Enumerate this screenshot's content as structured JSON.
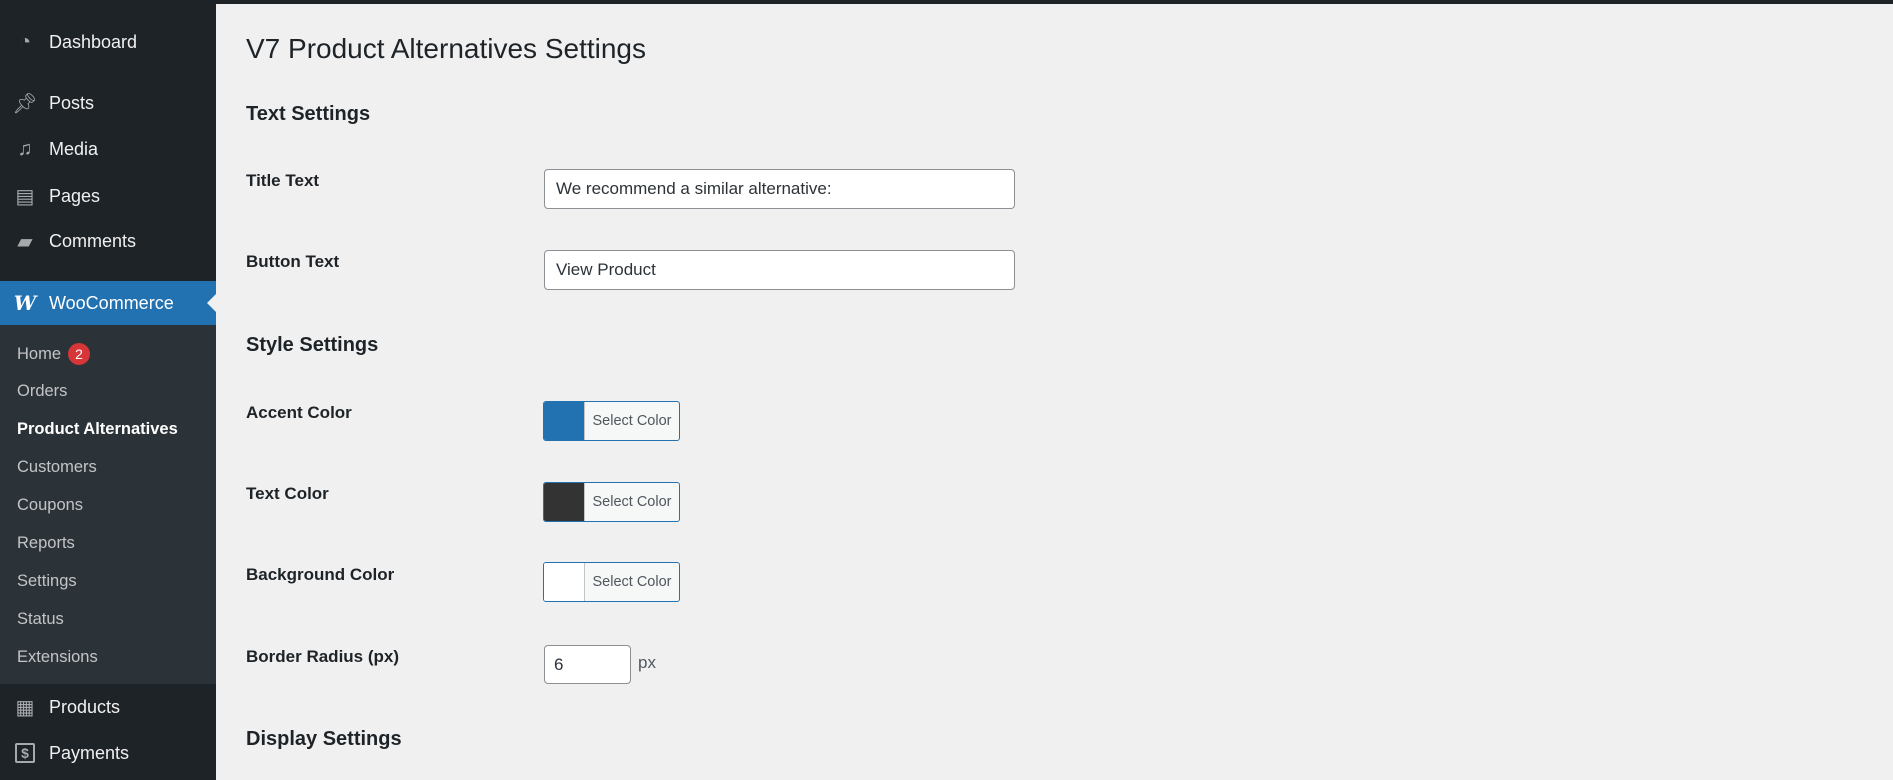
{
  "sidebar": {
    "items": [
      {
        "label": "Dashboard",
        "icon": "dashboard-icon"
      },
      {
        "label": "Posts",
        "icon": "pin-icon"
      },
      {
        "label": "Media",
        "icon": "media-icon"
      },
      {
        "label": "Pages",
        "icon": "pages-icon"
      },
      {
        "label": "Comments",
        "icon": "comment-icon"
      },
      {
        "label": "WooCommerce",
        "icon": "woocommerce-icon",
        "glyph": "W"
      },
      {
        "label": "Products",
        "icon": "archive-icon"
      },
      {
        "label": "Payments",
        "icon": "dollar-icon",
        "glyph": "$"
      }
    ],
    "submenu": [
      {
        "label": "Home",
        "badge": "2"
      },
      {
        "label": "Orders"
      },
      {
        "label": "Product Alternatives"
      },
      {
        "label": "Customers"
      },
      {
        "label": "Coupons"
      },
      {
        "label": "Reports"
      },
      {
        "label": "Settings"
      },
      {
        "label": "Status"
      },
      {
        "label": "Extensions"
      }
    ]
  },
  "page": {
    "title": "V7 Product Alternatives Settings",
    "text_settings": {
      "heading": "Text Settings",
      "title_label": "Title Text",
      "title_value": "We recommend a similar alternative:",
      "button_label": "Button Text",
      "button_value": "View Product"
    },
    "style_settings": {
      "heading": "Style Settings",
      "accent_label": "Accent Color",
      "accent_color": "#2271b1",
      "text_label": "Text Color",
      "text_color": "#333333",
      "bg_label": "Background Color",
      "bg_color": "#ffffff",
      "select_color": "Select Color",
      "radius_label": "Border Radius (px)",
      "radius_value": "6",
      "radius_unit": "px"
    },
    "display_settings": {
      "heading": "Display Settings"
    }
  }
}
